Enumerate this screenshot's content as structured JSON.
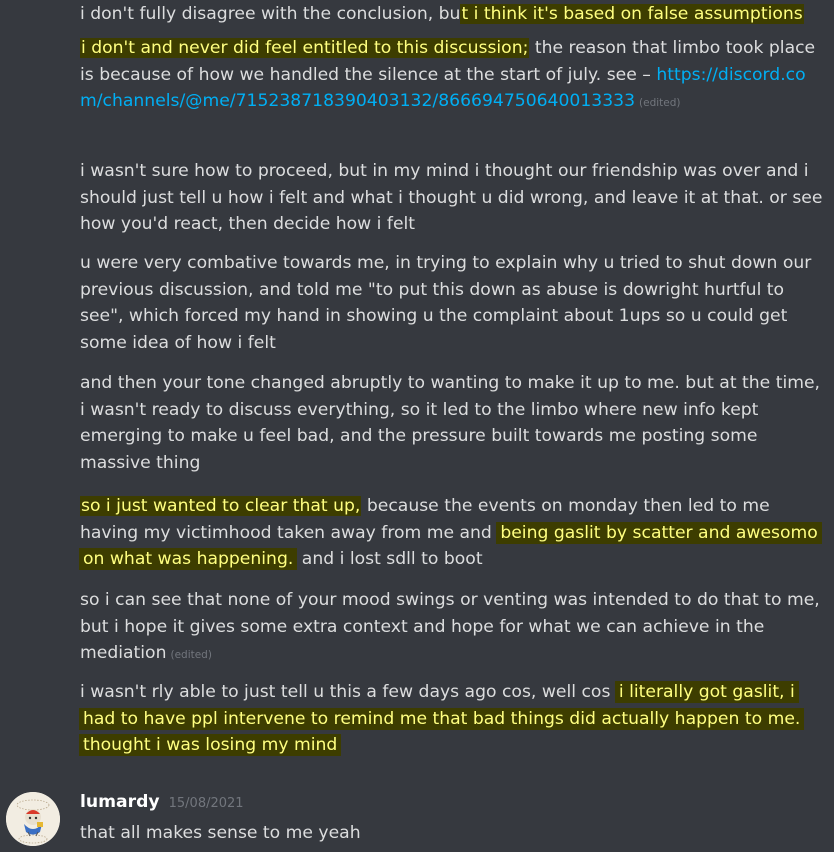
{
  "messages": [
    {
      "pre": "i don't fully disagree with the conclusion, bu",
      "hl": "t i think it's based on false assumptions"
    },
    {
      "hl": "i don't and never did feel entitled to this discussion;",
      "post": " the reason that limbo took place is because of how we handled the silence at the start of july. see – ",
      "link": "https://discord.com/channels/@me/715238718390403132/866694750640013333",
      "edited": "(edited)"
    },
    {
      "text": "i wasn't sure how to proceed, but in my mind i thought our friendship was over and i should just tell u how i felt and what i thought u did wrong, and leave it at that. or see how you'd react, then decide how i felt"
    },
    {
      "text": "u were very combative towards me, in trying to explain why u tried to shut down our previous discussion, and told me \"to put this down as abuse is dowright hurtful to see\", which forced my hand in showing u the complaint about 1ups so u could get some idea of how i felt"
    },
    {
      "text": "and then your tone changed abruptly to wanting to make it up to me. but at the time, i wasn't ready to discuss everything, so it led to the limbo where new info kept emerging to make u feel bad, and the pressure built towards me posting some massive thing"
    },
    {
      "hl1": "so i just wanted to clear that up,",
      "mid": " because the events on monday then led to me having my victimhood taken away from me and ",
      "hl2": "being gaslit by scatter and awesomo on what was happening.",
      "post": " and i lost sdll to boot"
    },
    {
      "text": "so i can see that none of your mood swings or venting was intended to do that to me, but i hope it gives some extra context and hope for what we can achieve in the mediation",
      "edited": "(edited)"
    },
    {
      "pre": "i wasn't rly able to just tell u this a few days ago cos, well cos ",
      "hl": "i literally got gaslit, i had to have ppl intervene to remind me that bad things did actually happen to me. thought i was losing my mind"
    }
  ],
  "reply": {
    "username": "lumardy",
    "timestamp": "15/08/2021",
    "text": "that all makes sense to me yeah"
  }
}
